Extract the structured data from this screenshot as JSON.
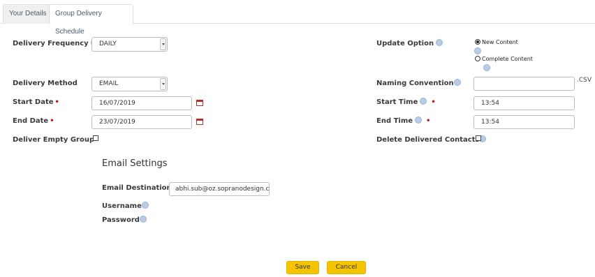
{
  "tabs": [
    {
      "label": "Your Details",
      "active": false
    },
    {
      "label": "Group Delivery Schedule",
      "active": true
    }
  ],
  "left": {
    "delivery_frequency": {
      "label": "Delivery Frequency",
      "value": "DAILY"
    },
    "delivery_method": {
      "label": "Delivery Method",
      "value": "EMAIL"
    },
    "start_date": {
      "label": "Start Date",
      "value": "16/07/2019"
    },
    "end_date": {
      "label": "End Date",
      "value": "23/07/2019"
    },
    "deliver_empty_group": {
      "label": "Deliver Empty Group",
      "checked": false
    }
  },
  "right": {
    "update_option": {
      "label": "Update Option",
      "options": [
        {
          "label": "New Content",
          "selected": true
        },
        {
          "label": "Complete Content",
          "selected": false
        }
      ]
    },
    "naming_convention": {
      "label": "Naming Convention",
      "value": "",
      "suffix": ".CSV"
    },
    "start_time": {
      "label": "Start Time",
      "value": "13:54"
    },
    "end_time": {
      "label": "End Time",
      "value": "13:54"
    },
    "delete_delivered_contacts": {
      "label": "Delete Delivered Contacts",
      "checked": false
    }
  },
  "email_settings": {
    "title": "Email Settings",
    "email_destination": {
      "label": "Email Destination",
      "value": "abhi.sub@oz.sopranodesign.co"
    },
    "username": {
      "label": "Username"
    },
    "password": {
      "label": "Password"
    }
  },
  "buttons": {
    "save": "Save",
    "cancel": "Cancel"
  },
  "colors": {
    "required": "#c0121a",
    "button": "#f5c400",
    "help_icon": "#b9cce6"
  }
}
